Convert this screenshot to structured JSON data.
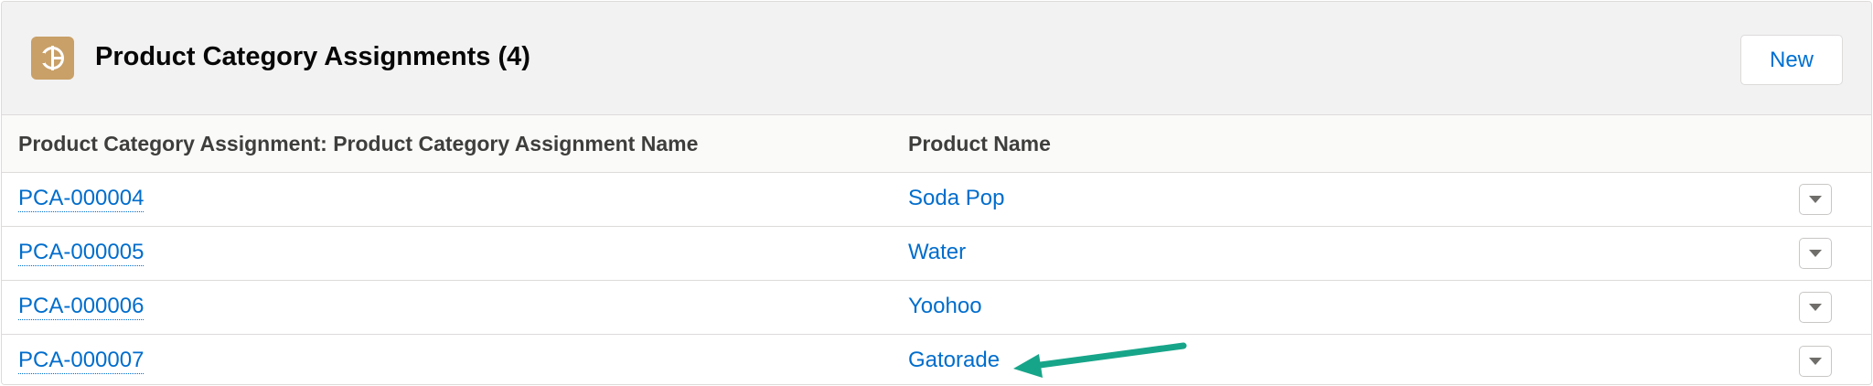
{
  "header": {
    "title": "Product Category Assignments (4)",
    "icon": "product-category-icon",
    "icon_color": "#c8a068",
    "new_label": "New"
  },
  "table": {
    "columns": [
      "Product Category Assignment: Product Category Assignment Name",
      "Product Name"
    ],
    "rows": [
      {
        "name": "PCA-000004",
        "product": "Soda Pop"
      },
      {
        "name": "PCA-000005",
        "product": "Water"
      },
      {
        "name": "PCA-000006",
        "product": "Yoohoo"
      },
      {
        "name": "PCA-000007",
        "product": "Gatorade"
      }
    ],
    "row_action_icon": "chevron-down-icon"
  },
  "annotation": {
    "arrow_color": "#17a589",
    "arrow_target": "Gatorade"
  },
  "colors": {
    "link": "#006dcc",
    "header_bg": "#f3f2f2",
    "border": "#dddbda"
  }
}
